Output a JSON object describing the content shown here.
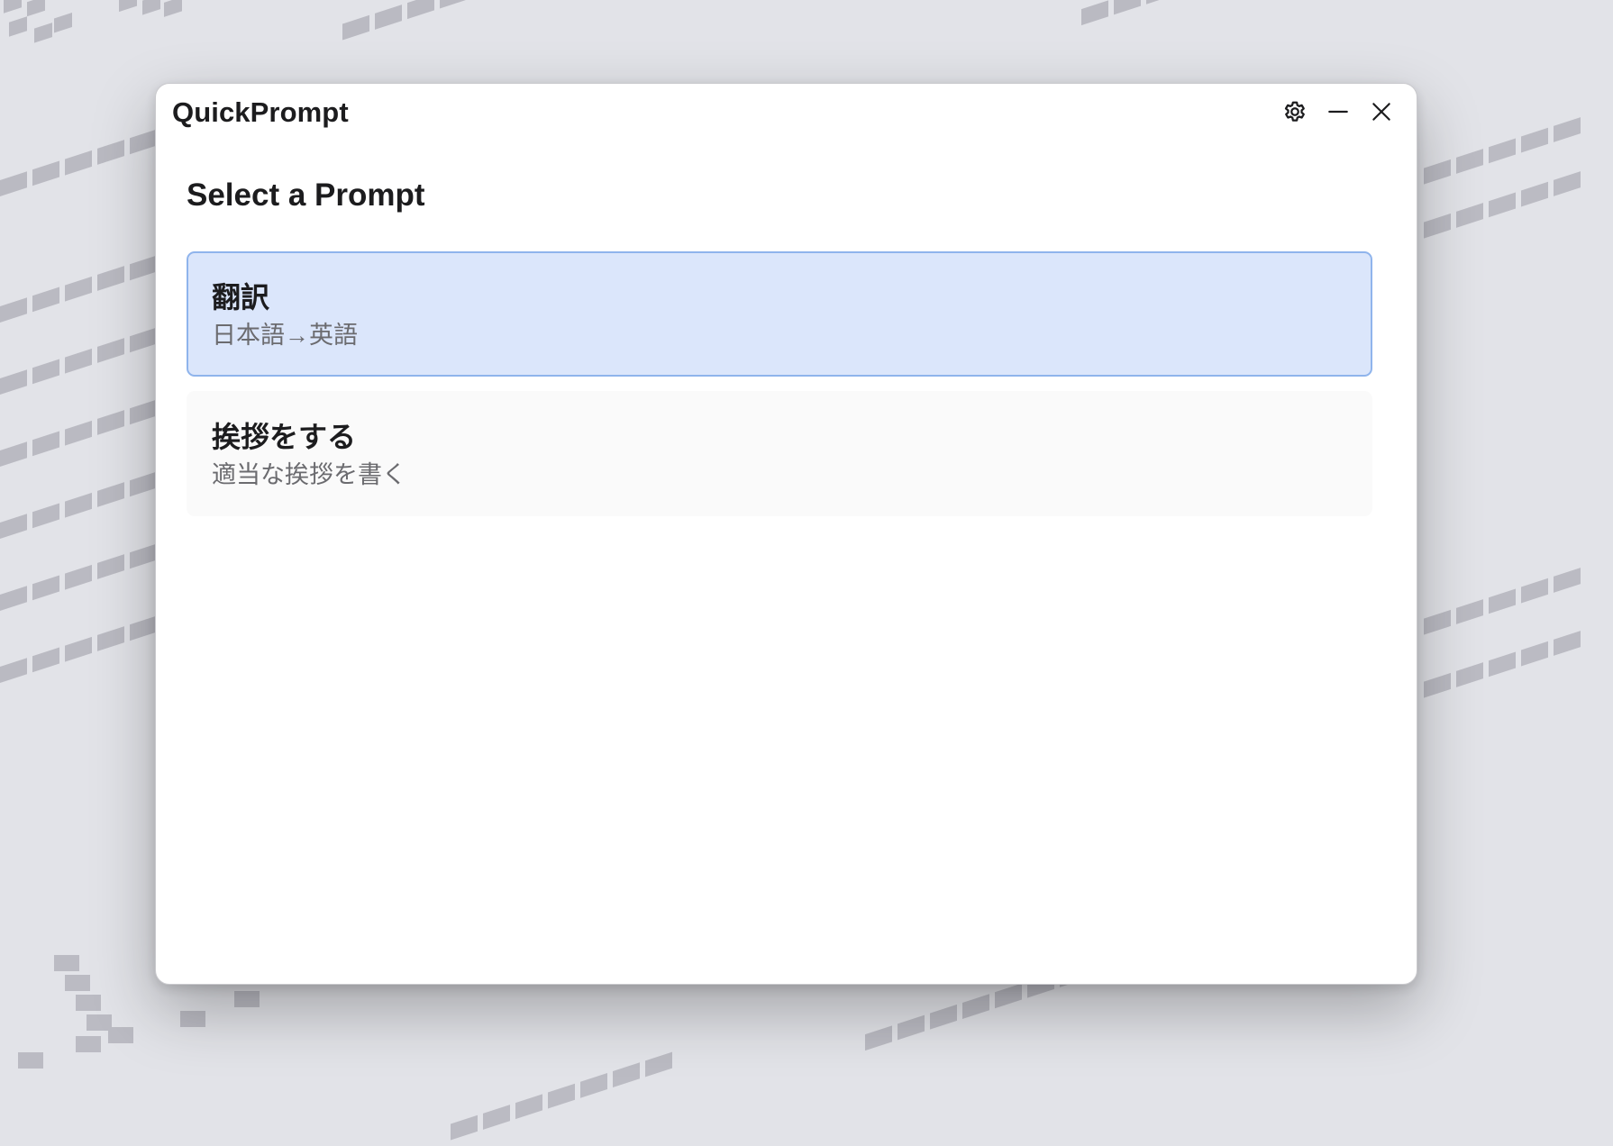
{
  "window": {
    "title": "QuickPrompt"
  },
  "controls": {
    "settings_icon": "gear-icon",
    "minimize_icon": "minus-icon",
    "close_icon": "close-icon"
  },
  "main": {
    "heading": "Select a Prompt",
    "prompts": [
      {
        "name": "翻訳",
        "description": "日本語→英語",
        "selected": true
      },
      {
        "name": "挨拶をする",
        "description": "適当な挨拶を書く",
        "selected": false
      }
    ]
  },
  "colors": {
    "selected_background": "#dbe6fb",
    "selected_border": "#8fb4ec",
    "item_background": "#fafafa"
  }
}
